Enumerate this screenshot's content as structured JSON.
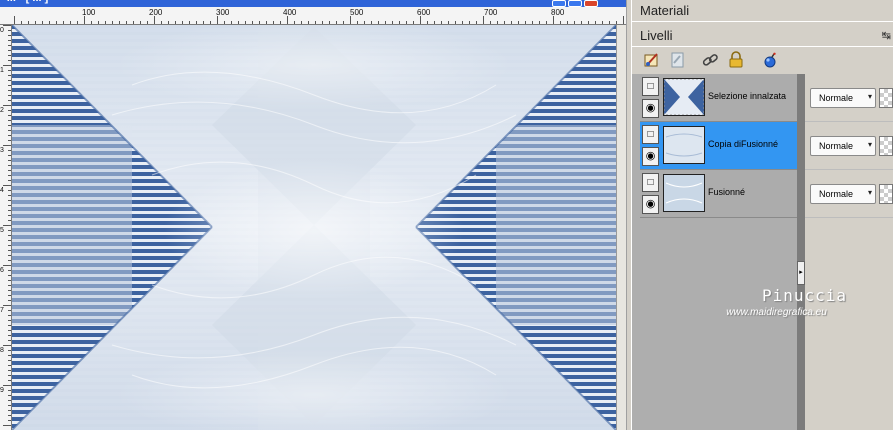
{
  "document": {
    "title": "- ... - [ ... ]",
    "ruler_top_labels": [
      "100",
      "200",
      "300",
      "400",
      "500",
      "600",
      "700",
      "800"
    ],
    "ruler_left_labels": [
      "0",
      "1",
      "2",
      "3",
      "4",
      "5",
      "6",
      "7",
      "8",
      "9"
    ]
  },
  "palettes": {
    "materiali": {
      "title": "Materiali"
    },
    "livelli": {
      "title": "Livelli"
    }
  },
  "toolbar": {
    "icons": [
      "new-raster-layer-icon",
      "new-vector-layer-icon",
      "link-icon",
      "lock-icon",
      "delete-layer-icon"
    ]
  },
  "layers": [
    {
      "name": "Selezione innalzata",
      "blend": "Normale",
      "selected": false
    },
    {
      "name": "Copia diFusionné",
      "blend": "Normale",
      "selected": true
    },
    {
      "name": "Fusionné",
      "blend": "Normale",
      "selected": false
    }
  ],
  "watermark": {
    "name": "Pinuccia",
    "url": "www.maidiregrafica.eu"
  },
  "colors": {
    "stripe_blue": "#3d63a0",
    "canvas_light": "#dde4ee",
    "selected_layer": "#3396f2",
    "titlebar": "#2f64d8"
  }
}
